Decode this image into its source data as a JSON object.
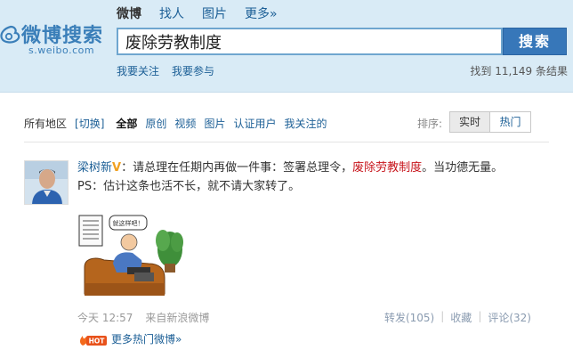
{
  "logo": {
    "cn": "微博搜索",
    "en": "s.weibo.com"
  },
  "topnav": [
    {
      "label": "微博",
      "active": true
    },
    {
      "label": "找人",
      "active": false
    },
    {
      "label": "图片",
      "active": false
    },
    {
      "label": "更多»",
      "active": false
    }
  ],
  "search": {
    "query": "废除劳教制度",
    "button_label": "搜索"
  },
  "sublinks": {
    "followed": "我要关注",
    "participate": "我要参与"
  },
  "result_count": "找到 11,149 条结果",
  "filter": {
    "region": "所有地区",
    "switch": "[切换]",
    "all": "全部",
    "tabs": [
      "原创",
      "视频",
      "图片",
      "认证用户",
      "我关注的"
    ]
  },
  "sort": {
    "label": "排序:",
    "realtime": "实时",
    "hot": "热门"
  },
  "post": {
    "author": "梁树新",
    "text_before": "：请总理在任期内再做一件事：签署总理令，",
    "keyword": "废除劳教制度",
    "text_after": "。当功德无量。PS：估计这条也活不长，就不请大家转了。",
    "image_caption_bubble": "就这样吧！",
    "time": "今天 12:57",
    "source": "来自新浪微博",
    "repost": "转发(105)",
    "favorite": "收藏",
    "comment": "评论(32)"
  },
  "more_hot": {
    "badge": "HOT",
    "label": "更多热门微博»"
  },
  "colors": {
    "header_bg": "#d9ebf6",
    "link": "#1c5f96",
    "keyword": "#c8161d",
    "button": "#3777b9"
  }
}
